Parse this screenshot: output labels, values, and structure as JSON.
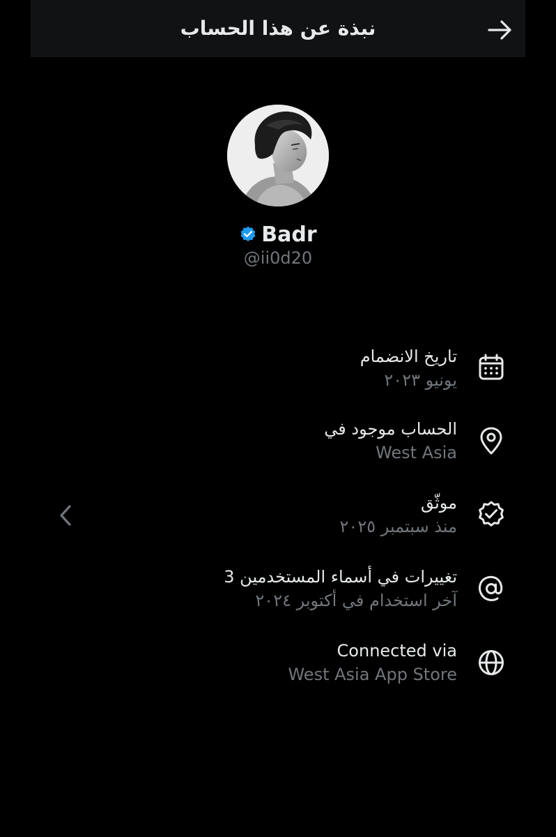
{
  "header": {
    "title": "نبذة عن هذا الحساب",
    "back_icon": "arrow-right-icon"
  },
  "profile": {
    "display_name": "Badr",
    "handle": "@ii0d20",
    "verified_color": "#1d9bf0",
    "avatar": "avatar-image"
  },
  "rows": [
    {
      "icon": "calendar-icon",
      "title": "تاريخ الانضمام",
      "subtitle": "يونيو ٢٠٢٣"
    },
    {
      "icon": "location-pin-icon",
      "title": "الحساب موجود في",
      "subtitle": "West Asia"
    },
    {
      "icon": "verified-badge-icon",
      "title": "موثّق",
      "subtitle": "منذ سبتمبر ٢٠٢٥"
    },
    {
      "icon": "at-sign-icon",
      "title": "3 تغييرات في أسماء المستخدمين",
      "subtitle": "آخر استخدام في أكتوبر ٢٠٢٤"
    },
    {
      "icon": "globe-icon",
      "title": "Connected via",
      "subtitle": "West Asia App Store"
    }
  ],
  "chevron_icon": "chevron-left-icon",
  "colors": {
    "background": "#000000",
    "header_background": "#111213",
    "primary_text": "#e7e9ea",
    "secondary_text": "#71767b"
  }
}
